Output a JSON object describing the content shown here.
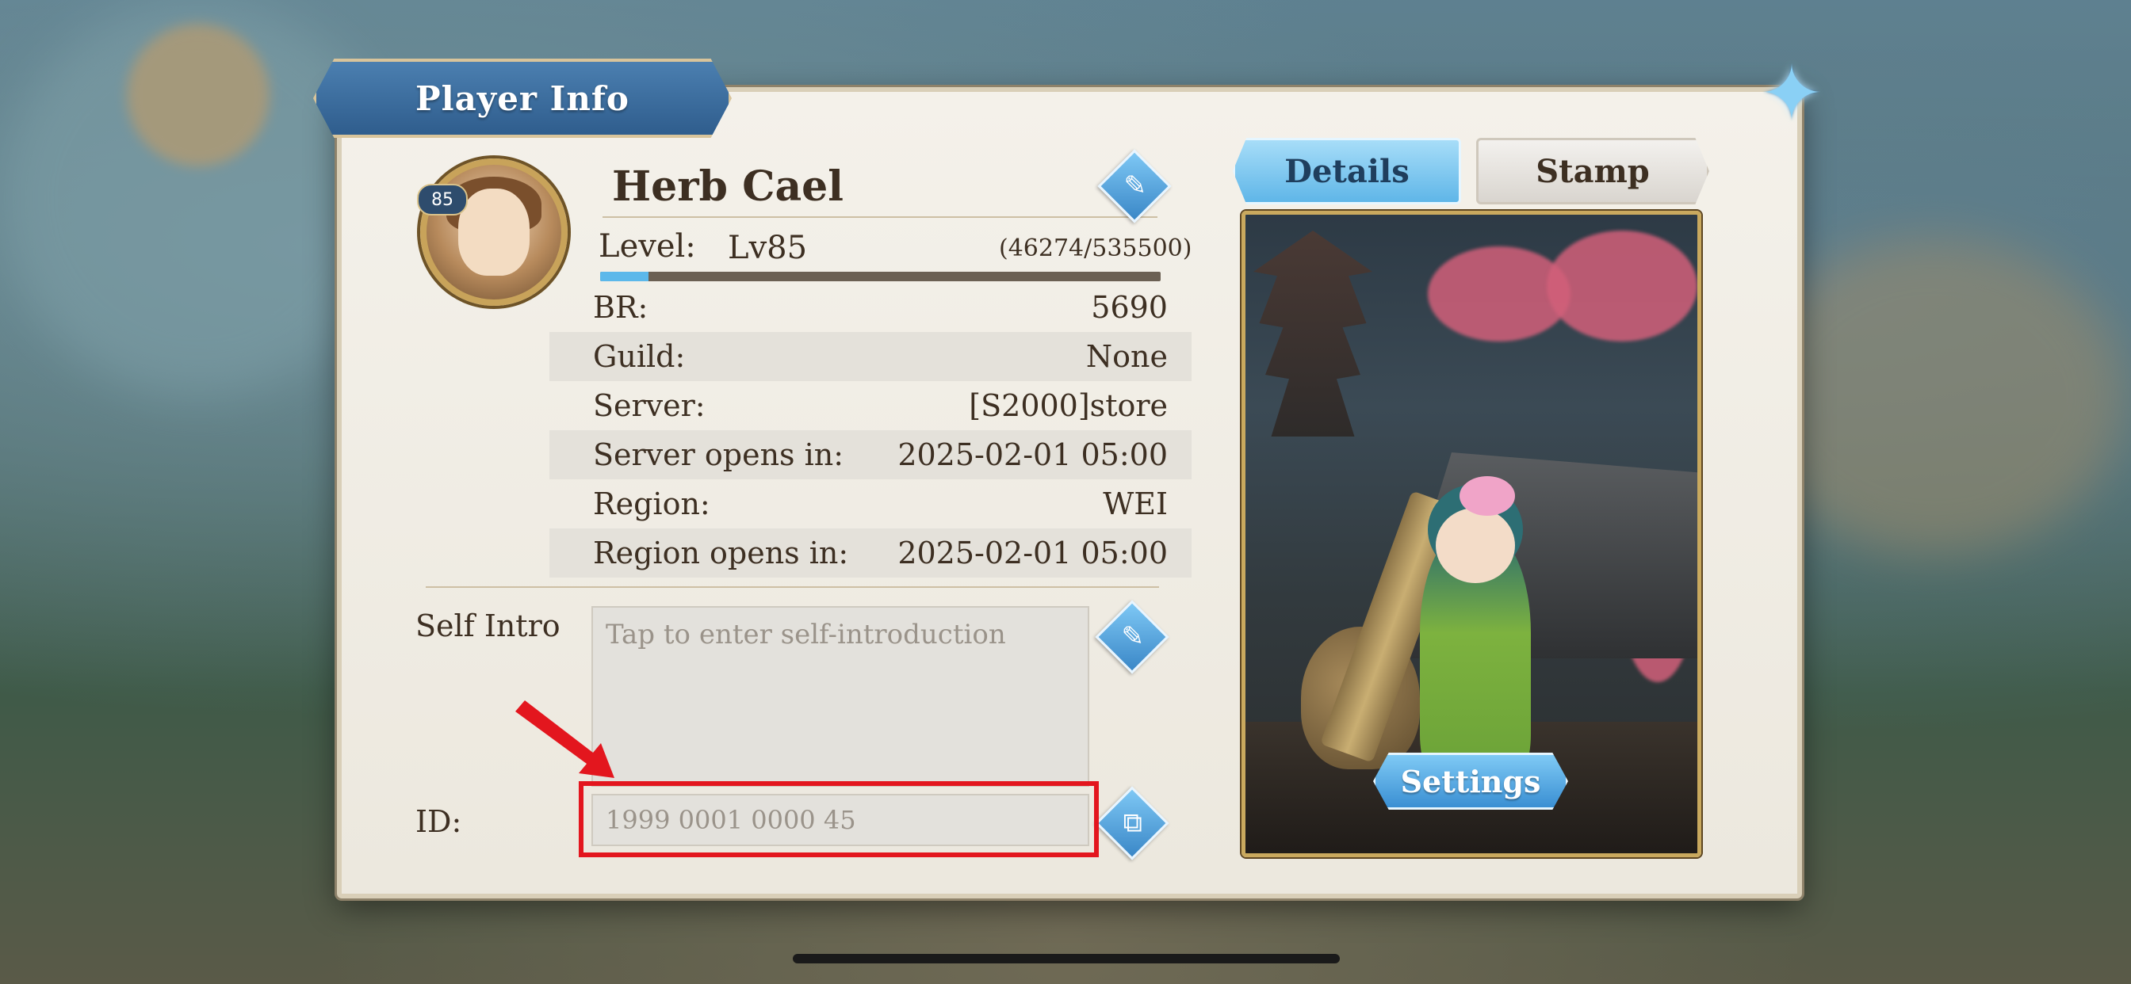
{
  "dialog": {
    "title": "Player Info"
  },
  "player": {
    "avatar_level": "85",
    "name": "Herb Cael",
    "level_label": "Level:",
    "level_value": "Lv85",
    "exp_text": "(46274/535500)",
    "exp_progress": 0.0864
  },
  "info_rows": [
    {
      "label": "BR:",
      "value": "5690"
    },
    {
      "label": "Guild:",
      "value": "None"
    },
    {
      "label": "Server:",
      "value": "[S2000]store"
    },
    {
      "label": "Server opens in:",
      "value": "2025-02-01 05:00"
    },
    {
      "label": "Region:",
      "value": "WEI"
    },
    {
      "label": "Region opens in:",
      "value": "2025-02-01 05:00"
    }
  ],
  "self_intro": {
    "label": "Self Intro",
    "placeholder": "Tap to enter self-introduction"
  },
  "id_field": {
    "label": "ID:",
    "value": "1999 0001 0000 45"
  },
  "tabs": [
    {
      "label": "Details",
      "active": true
    },
    {
      "label": "Stamp",
      "active": false
    }
  ],
  "settings_button": "Settings",
  "icons": {
    "close": "close-icon",
    "edit": "pencil-icon",
    "copy": "copy-icon"
  },
  "colors": {
    "accent_blue": "#5cb8ea",
    "highlight_red": "#e3161e",
    "text_brown": "#3d2f22"
  }
}
